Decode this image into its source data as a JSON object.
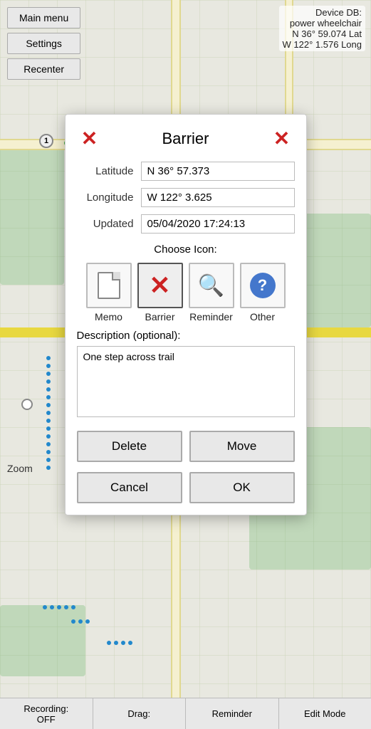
{
  "topButtons": {
    "mainMenu": "Main menu",
    "settings": "Settings",
    "recenter": "Recenter"
  },
  "topRight": {
    "line1": "Device DB:",
    "line2": "power wheelchair",
    "line3": "N 36° 59.074  Lat",
    "line4": "W 122° 1.576  Long"
  },
  "modal": {
    "title": "Barrier",
    "closeLeftLabel": "close-left",
    "closeRightLabel": "close-right",
    "latitudeLabel": "Latitude",
    "latitudeValue": "N 36° 57.373",
    "longitudeLabel": "Longitude",
    "longitudeValue": "W 122° 3.625",
    "updatedLabel": "Updated",
    "updatedValue": "05/04/2020 17:24:13",
    "chooseIconLabel": "Choose Icon:",
    "icons": [
      {
        "name": "Memo",
        "type": "memo"
      },
      {
        "name": "Barrier",
        "type": "barrier"
      },
      {
        "name": "Reminder",
        "type": "reminder"
      },
      {
        "name": "Other",
        "type": "other"
      }
    ],
    "descriptionLabel": "Description (optional):",
    "descriptionValue": "One step across trail",
    "deleteLabel": "Delete",
    "moveLabel": "Move",
    "cancelLabel": "Cancel",
    "okLabel": "OK"
  },
  "bottomBar": {
    "items": [
      {
        "label": "Recording:\nOFF"
      },
      {
        "label": "Drag:"
      },
      {
        "label": "Reminder"
      },
      {
        "label": "Edit Mode"
      }
    ]
  },
  "zoomLabel": "Zoom"
}
